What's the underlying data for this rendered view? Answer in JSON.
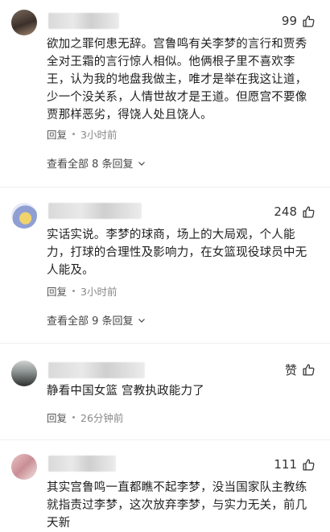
{
  "comments": [
    {
      "likes": "99",
      "text": "欲加之罪何患无辞。宫鲁鸣有关李梦的言行和贾秀全对王霜的言行惊人相似。他俩根子里不喜欢李王，认为我的地盘我做主，唯才是举在我这让道，少一个没关系，人情世故才是王道。但愿宫不要像贾那样恶劣，得饶人处且饶人。",
      "reply_label": "回复",
      "time": "3小时前",
      "view_all": "查看全部 8 条回复"
    },
    {
      "likes": "248",
      "text": "实话实说。李梦的球商，场上的大局观，个人能力，打球的合理性及影响力，在女篮现役球员中无人能及。",
      "reply_label": "回复",
      "time": "3小时前",
      "view_all": "查看全部 9 条回复"
    },
    {
      "likes": "赞",
      "text": "静看中国女篮 宫教执政能力了",
      "reply_label": "回复",
      "time": "26分钟前"
    },
    {
      "likes": "111",
      "text": "其实宫鲁鸣一直都瞧不起李梦，没当国家队主教练就指责过李梦，这次放弃李梦，与实力无关，前几天新"
    }
  ],
  "icons": {
    "like": "thumbs-up-icon",
    "expand": "chevron-down-icon"
  }
}
